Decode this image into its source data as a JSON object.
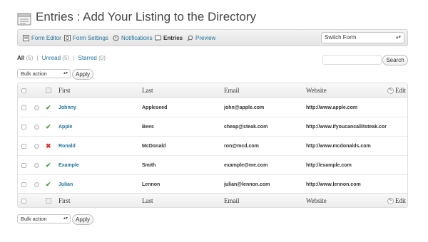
{
  "header": {
    "title": "Entries : Add Your Listing to the Directory"
  },
  "toolbar": {
    "items": [
      {
        "label": "Form Editor"
      },
      {
        "label": "Form Settings"
      },
      {
        "label": "Notifications"
      },
      {
        "label": "Entries"
      },
      {
        "label": "Preview"
      }
    ],
    "switch_form": "Switch Form"
  },
  "filters": {
    "all": {
      "label": "All",
      "count": "(5)"
    },
    "unread": {
      "label": "Unread",
      "count": "(5)"
    },
    "starred": {
      "label": "Starred",
      "count": "(0)"
    },
    "separator": "|"
  },
  "search": {
    "button": "Search",
    "value": ""
  },
  "bulk": {
    "label": "Bulk action",
    "arrow": "▴▾",
    "apply": "Apply"
  },
  "table": {
    "columns": [
      "First",
      "Last",
      "Email",
      "Website"
    ],
    "edit_label": "Edit",
    "rows": [
      {
        "status": "approved",
        "status_glyph": "✔",
        "first": "Johnny",
        "last": "Appleseed",
        "email": "john@apple.com",
        "website": "http://www.apple.com"
      },
      {
        "status": "approved",
        "status_glyph": "✔",
        "first": "Apple",
        "last": "Bees",
        "email": "cheap@steak.com",
        "website": "http://www.ifyoucancallitsteak.cor"
      },
      {
        "status": "rejected",
        "status_glyph": "✖",
        "first": "Ronald",
        "last": "McDonald",
        "email": "ron@mcd.com",
        "website": "http://www.mcdonalds.com"
      },
      {
        "status": "approved",
        "status_glyph": "✔",
        "first": "Example",
        "last": "Smith",
        "email": "example@me.com",
        "website": "http://example.com"
      },
      {
        "status": "approved",
        "status_glyph": "✔",
        "first": "Julian",
        "last": "Lennon",
        "email": "julian@lennon.com",
        "website": "http://www.lennon.com"
      }
    ]
  },
  "colors": {
    "link": "#21759b",
    "approved": "#4a9b3c",
    "rejected": "#d9362b"
  }
}
